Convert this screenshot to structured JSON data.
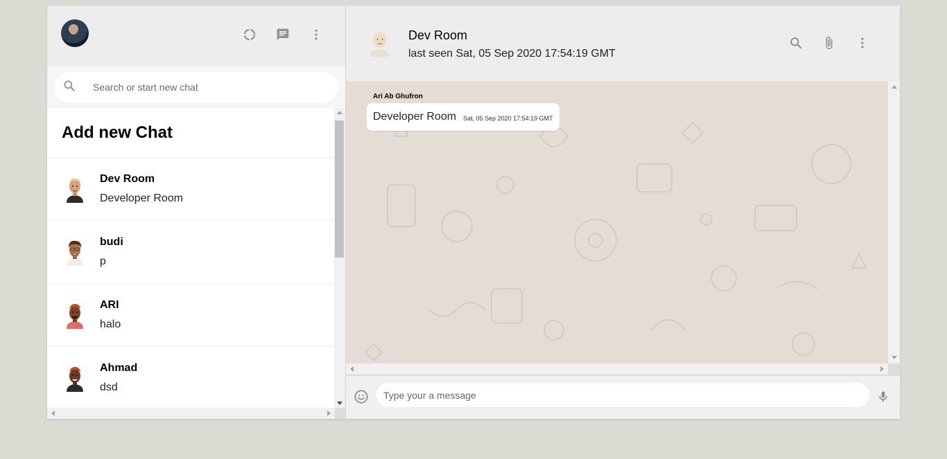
{
  "sidebar": {
    "header": {
      "icons": [
        "status-icon",
        "new-chat-icon",
        "menu-icon"
      ]
    },
    "search": {
      "placeholder": "Search or start new chat"
    },
    "add_chat_label": "Add new Chat",
    "chats": [
      {
        "name": "Dev Room",
        "last_message": "Developer Room"
      },
      {
        "name": "budi",
        "last_message": "p"
      },
      {
        "name": "ARI",
        "last_message": "halo"
      },
      {
        "name": "Ahmad",
        "last_message": "dsd"
      }
    ]
  },
  "main": {
    "header": {
      "title": "Dev Room",
      "status": "last seen Sat, 05 Sep 2020 17:54:19 GMT",
      "icons": [
        "search-icon",
        "attach-icon",
        "menu-icon"
      ]
    },
    "messages": [
      {
        "sender": "Ari Ab Ghufron",
        "text": "Developer Room",
        "timestamp": "Sat, 05 Sep 2020 17:54:19 GMT"
      }
    ],
    "composer": {
      "placeholder": "Type your a message"
    }
  },
  "colors": {
    "page_bg": "#dadbd3",
    "header_bg": "#ededed",
    "chat_bg": "#e5ddd5",
    "icon": "#919191"
  }
}
